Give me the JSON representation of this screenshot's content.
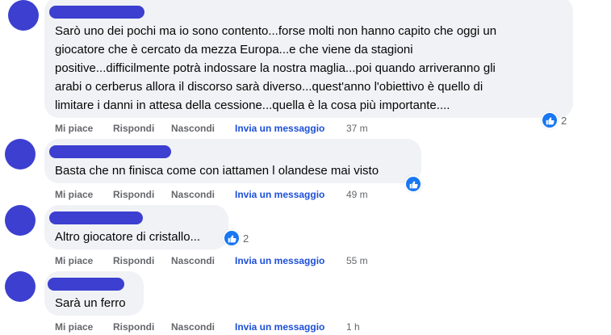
{
  "comments": [
    {
      "text_lines": [
        "Sarò uno dei pochi ma io sono contento...forse molti non hanno capito che oggi un",
        "giocatore che è cercato da mezza Europa...e che viene da stagioni",
        "positive...difficilmente potrà indossare la nostra maglia...poi quando arriveranno gli",
        "arabi o cerberus allora il discorso sarà diverso...quest'anno l'obiettivo è quello di",
        "limitare i danni in attesa della cessione...quella è la cosa più importante...."
      ],
      "reaction_icon": "like-icon",
      "reaction_count": "2",
      "time": "37 m"
    },
    {
      "text_lines": [
        "Basta che nn finisca come con iattamen l olandese mai visto"
      ],
      "reaction_icon": "like-icon",
      "reaction_count": "",
      "time": "49 m"
    },
    {
      "text_lines": [
        "Altro giocatore di cristallo..."
      ],
      "reaction_icon": "like-icon",
      "reaction_count": "2",
      "time": "55 m"
    },
    {
      "text_lines": [
        "Sarà un ferro"
      ],
      "reaction_icon": "",
      "reaction_count": "",
      "time": "1 h"
    }
  ],
  "actions": {
    "like": "Mi piace",
    "reply": "Rispondi",
    "hide": "Nascondi",
    "send_message": "Invia un messaggio"
  },
  "colors": {
    "avatar": "#3c3fcf",
    "bubble": "#f0f2f5",
    "link": "#1d4fd7",
    "like": "#1877f2"
  }
}
